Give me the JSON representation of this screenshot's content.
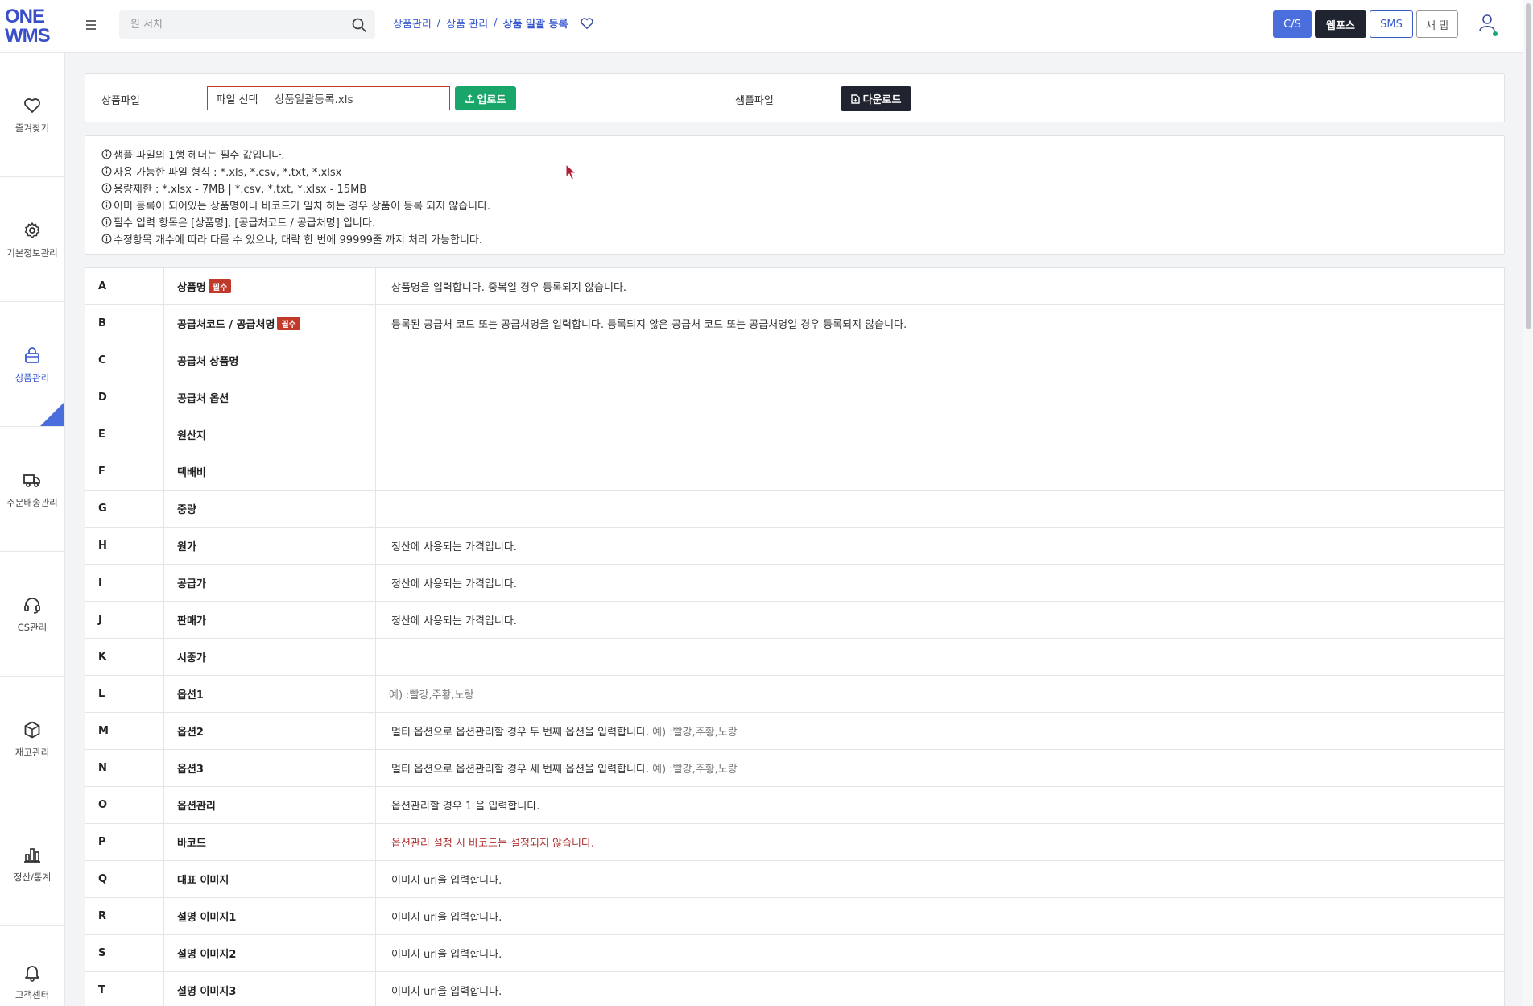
{
  "header": {
    "logo_line1": "ONE",
    "logo_line2": "WMS",
    "search_placeholder": "원 서치",
    "breadcrumb": [
      "상품관리",
      "상품 관리",
      "상품 일괄 등록"
    ],
    "buttons": {
      "cs": "C/S",
      "webpos": "웹포스",
      "sms": "SMS",
      "newtab": "새 탭"
    },
    "icons": {
      "menu": "hamburger-icon",
      "search": "search-icon",
      "favorite": "heart-icon",
      "user": "user-icon"
    }
  },
  "sidebar": {
    "items": [
      {
        "label": "즐겨찾기",
        "icon": "heart-icon"
      },
      {
        "label": "기본정보관리",
        "icon": "gear-icon"
      },
      {
        "label": "상품관리",
        "icon": "bag-icon",
        "active": true
      },
      {
        "label": "주문배송관리",
        "icon": "truck-icon"
      },
      {
        "label": "CS관리",
        "icon": "headset-icon"
      },
      {
        "label": "재고관리",
        "icon": "box-icon"
      },
      {
        "label": "정산/통계",
        "icon": "bar-chart-icon"
      },
      {
        "label": "고객센터",
        "icon": "bell-icon"
      }
    ]
  },
  "upload": {
    "file_label": "상품파일",
    "choose_label": "파일 선택",
    "file_name": "상품일괄등록.xls",
    "upload_label": "업로드",
    "sample_label": "샘플파일",
    "download_label": "다운로드"
  },
  "notices": [
    "샘플 파일의 1행 헤더는 필수 값입니다.",
    "사용 가능한 파일 형식 : *.xls, *.csv, *.txt, *.xlsx",
    "용량제한 : *.xlsx - 7MB | *.csv, *.txt, *.xlsx - 15MB",
    "이미 등록이 되어있는 상품명이나 바코드가 일치 하는 경우 상품이 등록 되지 않습니다.",
    "필수 입력 항목은 [상품명], [공급처코드 / 공급처명] 입니다.",
    "수정항목 개수에 따라 다를 수 있으나, 대략 한 번에 99999줄 까지 처리 가능합니다."
  ],
  "required_badge": "필수",
  "fields": [
    {
      "col": "A",
      "name": "상품명",
      "required": true,
      "desc": "상품명을 입력합니다. 중복일 경우 등록되지 않습니다.",
      "example": "",
      "warn": false
    },
    {
      "col": "B",
      "name": "공급처코드 / 공급처명",
      "required": true,
      "desc": "등록된 공급처 코드 또는 공급처명을 입력합니다. 등록되지 않은 공급처 코드 또는 공급처명일 경우 등록되지 않습니다.",
      "example": "",
      "warn": false
    },
    {
      "col": "C",
      "name": "공급처 상품명",
      "required": false,
      "desc": "",
      "example": "",
      "warn": false
    },
    {
      "col": "D",
      "name": "공급처 옵션",
      "required": false,
      "desc": "",
      "example": "",
      "warn": false
    },
    {
      "col": "E",
      "name": "원산지",
      "required": false,
      "desc": "",
      "example": "",
      "warn": false
    },
    {
      "col": "F",
      "name": "택배비",
      "required": false,
      "desc": "",
      "example": "",
      "warn": false
    },
    {
      "col": "G",
      "name": "중량",
      "required": false,
      "desc": "",
      "example": "",
      "warn": false
    },
    {
      "col": "H",
      "name": "원가",
      "required": false,
      "desc": "정산에 사용되는 가격입니다.",
      "example": "",
      "warn": false
    },
    {
      "col": "I",
      "name": "공급가",
      "required": false,
      "desc": "정산에 사용되는 가격입니다.",
      "example": "",
      "warn": false
    },
    {
      "col": "J",
      "name": "판매가",
      "required": false,
      "desc": "정산에 사용되는 가격입니다.",
      "example": "",
      "warn": false
    },
    {
      "col": "K",
      "name": "시중가",
      "required": false,
      "desc": "",
      "example": "",
      "warn": false
    },
    {
      "col": "L",
      "name": "옵션1",
      "required": false,
      "desc": "",
      "example": "예) :빨강,주황,노랑",
      "warn": false
    },
    {
      "col": "M",
      "name": "옵션2",
      "required": false,
      "desc": "멀티 옵션으로 옵션관리할 경우 두 번째 옵션을 입력합니다.",
      "example": "예) :빨강,주황,노랑",
      "warn": false
    },
    {
      "col": "N",
      "name": "옵션3",
      "required": false,
      "desc": "멀티 옵션으로 옵션관리할 경우 세 번째 옵션을 입력합니다.",
      "example": "예) :빨강,주황,노랑",
      "warn": false
    },
    {
      "col": "O",
      "name": "옵션관리",
      "required": false,
      "desc": "옵션관리할 경우 1 을 입력합니다.",
      "example": "",
      "warn": false
    },
    {
      "col": "P",
      "name": "바코드",
      "required": false,
      "desc": "옵션관리 설정 시 바코드는 설정되지 않습니다.",
      "example": "",
      "warn": true
    },
    {
      "col": "Q",
      "name": "대표 이미지",
      "required": false,
      "desc": "이미지 url을 입력합니다.",
      "example": "",
      "warn": false
    },
    {
      "col": "R",
      "name": "설명 이미지1",
      "required": false,
      "desc": "이미지 url을 입력합니다.",
      "example": "",
      "warn": false
    },
    {
      "col": "S",
      "name": "설명 이미지2",
      "required": false,
      "desc": "이미지 url을 입력합니다.",
      "example": "",
      "warn": false
    },
    {
      "col": "T",
      "name": "설명 이미지3",
      "required": false,
      "desc": "이미지 url을 입력합니다.",
      "example": "",
      "warn": false
    }
  ],
  "colors": {
    "accent": "#4a6fdc",
    "dark": "#1f2430",
    "success": "#1aa66a",
    "danger": "#c0392b"
  }
}
